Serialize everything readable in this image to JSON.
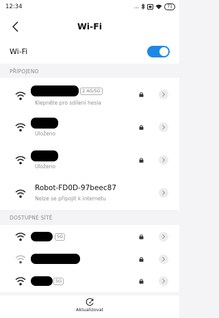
{
  "status_bar": {
    "time": "12:34",
    "signal_dots": "...",
    "battery": "71"
  },
  "header": {
    "title": "Wi-Fi"
  },
  "wifi": {
    "label": "Wi-Fi",
    "enabled": true
  },
  "sections": {
    "connected": "PŘIPOJENO",
    "available": "DOSTUPNÉ SÍTĚ"
  },
  "connected_networks": [
    {
      "name_redacted": true,
      "band": "2.4G/5G",
      "subtitle": "Klepněte pro sdílení hesla",
      "locked": true
    },
    {
      "name_redacted": true,
      "subtitle": "Uloženo",
      "locked": true
    },
    {
      "name_redacted": true,
      "subtitle": "Uloženo",
      "locked": true
    },
    {
      "name": "Robot-FD0D-97beec87",
      "subtitle": "Nelze se připojit k internetu",
      "locked": false
    }
  ],
  "available_networks": [
    {
      "name_redacted": true,
      "band": "5G",
      "locked": true
    },
    {
      "name_redacted": true,
      "locked": true
    },
    {
      "name_redacted": true,
      "band": "5G",
      "locked": true
    }
  ],
  "bottom": {
    "refresh_label": "Aktualizovat"
  },
  "colors": {
    "accent": "#1e88e5",
    "background": "#f4f4f6"
  }
}
